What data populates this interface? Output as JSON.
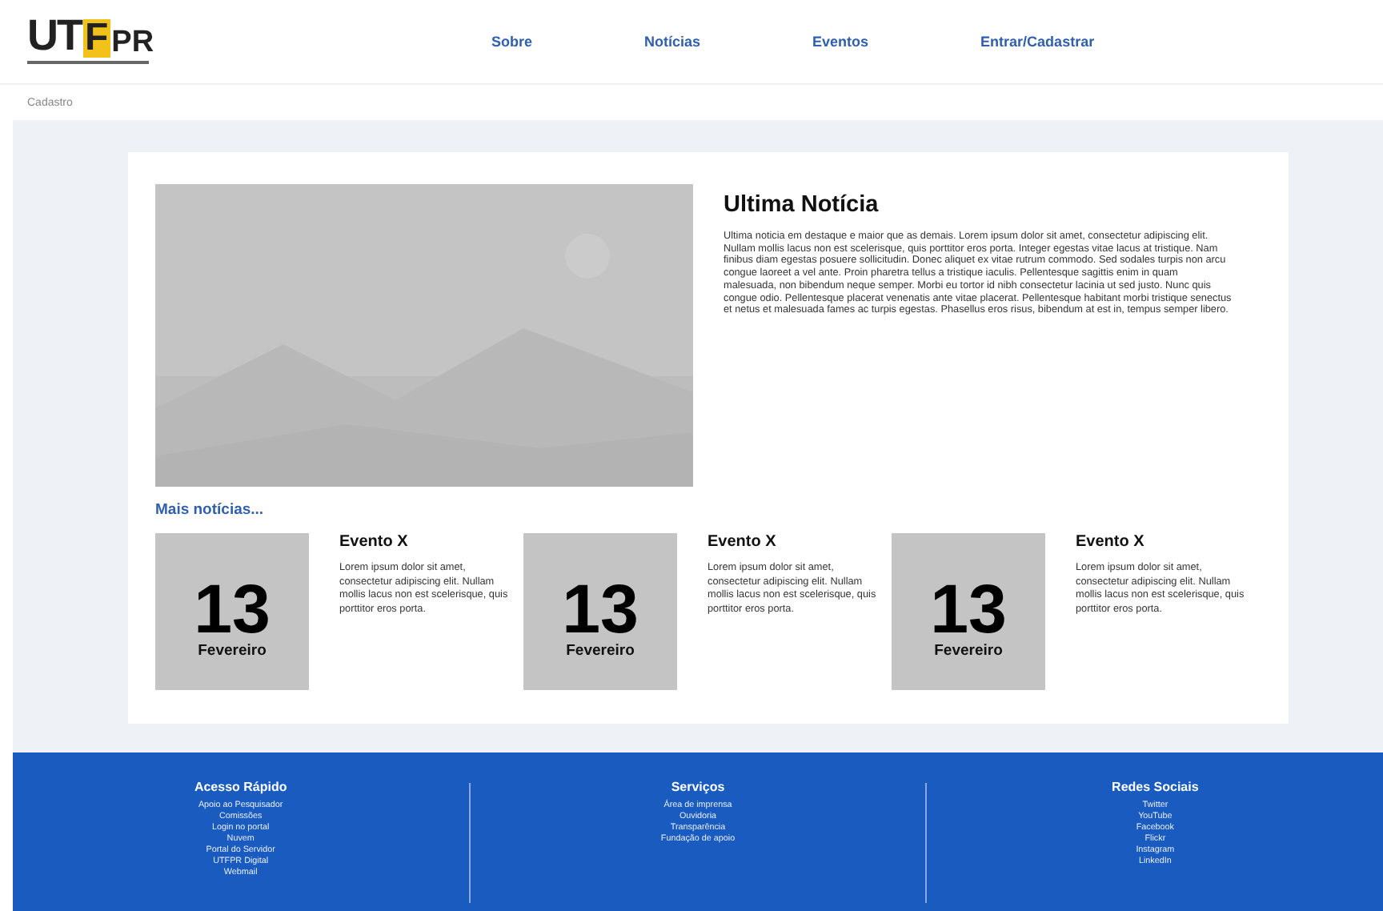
{
  "header": {
    "logo": {
      "letters": [
        "U",
        "T",
        "F",
        "PR"
      ]
    },
    "nav": [
      {
        "label": "Sobre"
      },
      {
        "label": "Notícias"
      },
      {
        "label": "Eventos"
      },
      {
        "label": "Entrar/Cadastrar"
      }
    ]
  },
  "breadcrumb": "Cadastro",
  "featured": {
    "title": "Ultima Notícia",
    "body": "Ultima noticia em destaque e maior que as demais. Lorem ipsum dolor sit amet, consectetur adipiscing elit. Nullam mollis lacus non est scelerisque, quis porttitor eros porta. Integer egestas vitae lacus at tristique. Nam finibus diam egestas posuere sollicitudin. Donec aliquet ex vitae rutrum commodo. Sed sodales turpis non arcu congue laoreet a vel ante. Proin pharetra tellus a tristique iaculis. Pellentesque sagittis enim in quam malesuada, non bibendum neque semper. Morbi eu tortor id nibh consectetur lacinia ut sed justo. Nunc quis congue odio. Pellentesque placerat venenatis ante vitae placerat. Pellentesque habitant morbi tristique senectus et netus et malesuada fames ac turpis egestas. Phasellus eros risus, bibendum at est in, tempus semper libero."
  },
  "more_link": "Mais notícias...",
  "events": [
    {
      "day": "13",
      "month": "Fevereiro",
      "title": "Evento X",
      "text": "Lorem ipsum dolor sit amet, consectetur adipiscing elit. Nullam mollis lacus non est scelerisque, quis porttitor eros porta."
    },
    {
      "day": "13",
      "month": "Fevereiro",
      "title": "Evento X",
      "text": "Lorem ipsum dolor sit amet, consectetur adipiscing elit. Nullam mollis lacus non est scelerisque, quis porttitor eros porta."
    },
    {
      "day": "13",
      "month": "Fevereiro",
      "title": "Evento X",
      "text": "Lorem ipsum dolor sit amet, consectetur adipiscing elit. Nullam mollis lacus non est scelerisque, quis porttitor eros porta."
    }
  ],
  "footer": [
    {
      "title": "Acesso Rápido",
      "links": [
        "Apoio ao Pesquisador",
        "Comissões",
        "Login no portal",
        "Nuvem",
        "Portal do Servidor",
        "UTFPR Digital",
        "Webmail"
      ]
    },
    {
      "title": "Serviços",
      "links": [
        "Área de imprensa",
        "Ouvidoria",
        "Transparência",
        "Fundação de apoio"
      ]
    },
    {
      "title": "Redes Sociais",
      "links": [
        "Twitter",
        "YouTube",
        "Facebook",
        "Flickr",
        "Instagram",
        "LinkedIn"
      ]
    }
  ]
}
